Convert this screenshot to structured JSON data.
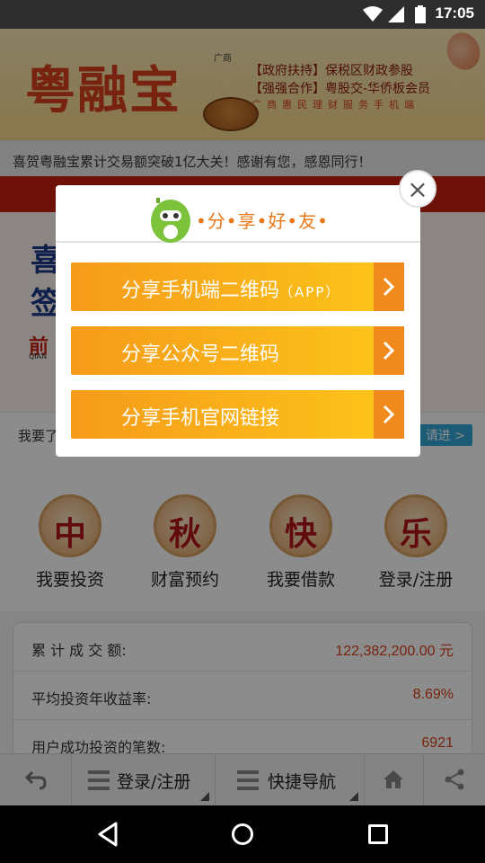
{
  "status_bar": {
    "time": "17:05"
  },
  "banner": {
    "logo": "粤融宝",
    "logo_sub": "广商",
    "slogan_line1": "【政府扶持】保税区财政参股",
    "slogan_line2": "【强强合作】粤股交-华侨板会员",
    "slogan_line3": "广商惠民理财服务手机端"
  },
  "notice": "喜贺粤融宝累计交易额突破1亿大关！感谢有您，感恩同行！",
  "carousel": {
    "line1": "喜",
    "line2": "签",
    "red_text": "前",
    "small_text": "QIAN",
    "bottom_text": "我要了",
    "button": "请进 >"
  },
  "features": [
    {
      "char": "中",
      "label": "我要投资"
    },
    {
      "char": "秋",
      "label": "财富预约"
    },
    {
      "char": "快",
      "label": "我要借款"
    },
    {
      "char": "乐",
      "label": "登录/注册"
    }
  ],
  "stats": [
    {
      "key": "累 计 成 交 额:",
      "value": "122,382,200.00 元"
    },
    {
      "key": "平均投资年收益率:",
      "value": "8.69%"
    },
    {
      "key": "用户成功投资的笔数:",
      "value": "6921"
    }
  ],
  "toolbar": {
    "login": "登录/注册",
    "nav": "快捷导航"
  },
  "dialog": {
    "title": "•分•享•好•友•",
    "options": [
      {
        "label": "分享手机端二维码",
        "suffix": "（APP）"
      },
      {
        "label": "分享公众号二维码",
        "suffix": ""
      },
      {
        "label": "分享手机官网链接",
        "suffix": ""
      }
    ],
    "close_label": "×"
  },
  "colors": {
    "accent_orange": "#f69b1a",
    "accent_yellow": "#fcc61a",
    "brand_red": "#d9411c",
    "link_blue": "#33a6d8"
  }
}
